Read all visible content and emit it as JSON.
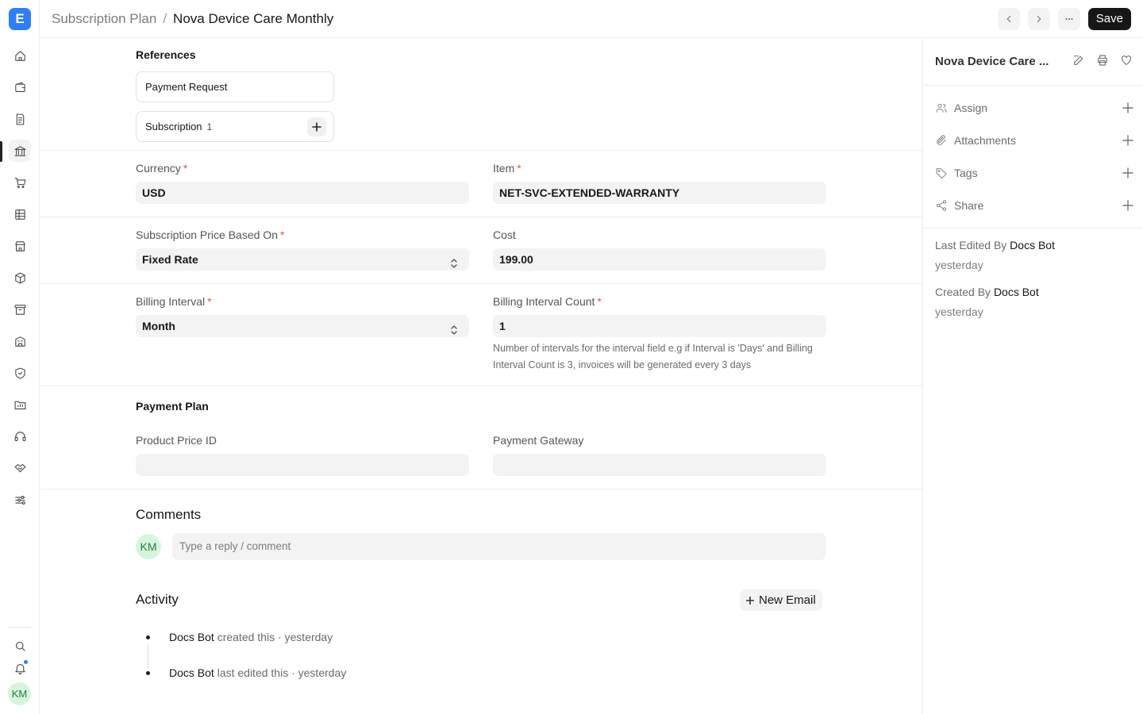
{
  "app": {
    "logo_letter": "E"
  },
  "breadcrumb": {
    "parent": "Subscription Plan",
    "separator": "/",
    "current": "Nova Device Care Monthly"
  },
  "toolbar": {
    "save_label": "Save"
  },
  "references": {
    "title": "References",
    "items": [
      {
        "label": "Payment Request",
        "count": ""
      },
      {
        "label": "Subscription",
        "count": "1"
      }
    ]
  },
  "form": {
    "currency": {
      "label": "Currency",
      "value": "USD"
    },
    "item": {
      "label": "Item",
      "value": "NET-SVC-EXTENDED-WARRANTY"
    },
    "price_based_on": {
      "label": "Subscription Price Based On",
      "value": "Fixed Rate"
    },
    "cost": {
      "label": "Cost",
      "value": "199.00"
    },
    "billing_interval": {
      "label": "Billing Interval",
      "value": "Month"
    },
    "billing_interval_count": {
      "label": "Billing Interval Count",
      "value": "1",
      "help": "Number of intervals for the interval field e.g if Interval is 'Days' and Billing Interval Count is 3, invoices will be generated every 3 days"
    },
    "payment_plan": {
      "title": "Payment Plan",
      "product_price_id": {
        "label": "Product Price ID",
        "value": ""
      },
      "payment_gateway": {
        "label": "Payment Gateway",
        "value": ""
      }
    }
  },
  "comments": {
    "title": "Comments",
    "avatar": "KM",
    "placeholder": "Type a reply / comment"
  },
  "activity": {
    "title": "Activity",
    "new_email": "New Email",
    "items": [
      {
        "who": "Docs Bot",
        "what": " created this · yesterday"
      },
      {
        "who": "Docs Bot",
        "what": " last edited this · yesterday"
      }
    ]
  },
  "sidebar": {
    "title": "Nova Device Care ...",
    "actions": [
      {
        "label": "Assign",
        "icon": "users-icon"
      },
      {
        "label": "Attachments",
        "icon": "paperclip-icon"
      },
      {
        "label": "Tags",
        "icon": "tag-icon"
      },
      {
        "label": "Share",
        "icon": "share-icon"
      }
    ],
    "last_edited": {
      "prefix": "Last Edited By ",
      "who": "Docs Bot",
      "when": "yesterday"
    },
    "created": {
      "prefix": "Created By ",
      "who": "Docs Bot",
      "when": "yesterday"
    }
  },
  "user": {
    "initials": "KM"
  },
  "colors": {
    "accent": "#2f7ef6",
    "required": "#e0554c",
    "save_bg": "#171717"
  }
}
